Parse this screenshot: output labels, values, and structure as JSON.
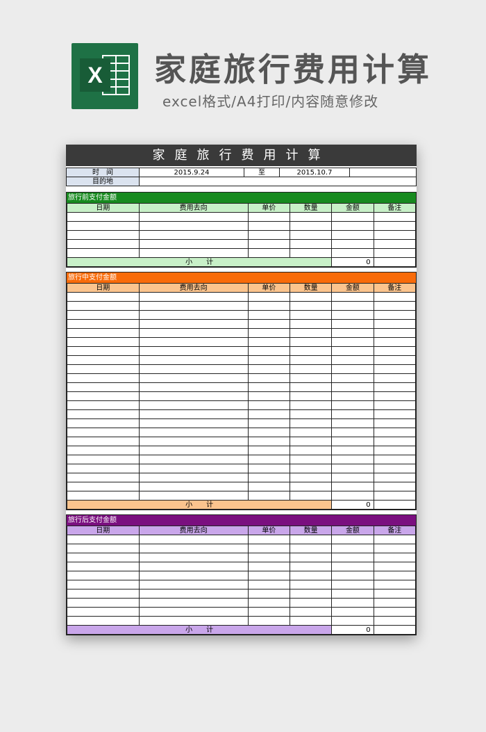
{
  "banner": {
    "logo_letter": "X",
    "title": "家庭旅行费用计算",
    "subtitle": "excel格式/A4打印/内容随意修改"
  },
  "sheet": {
    "title": "家庭旅行费用计算",
    "info": {
      "time_label": "时　间",
      "date_start": "2015.9.24",
      "to_label": "至",
      "date_end": "2015.10.7",
      "destination_label": "目的地",
      "destination_value": ""
    },
    "columns": [
      "日期",
      "费用去向",
      "单价",
      "数量",
      "金额",
      "备注"
    ],
    "sections": [
      {
        "title": "旅行前支付金额",
        "subtotal_label": "小　　计",
        "subtotal_value": "0",
        "rows": 5
      },
      {
        "title": "旅行中支付金额",
        "subtotal_label": "小　　计",
        "subtotal_value": "0",
        "rows": 23
      },
      {
        "title": "旅行后支付金额",
        "subtotal_label": "小　　计",
        "subtotal_value": "0",
        "rows": 10
      }
    ]
  },
  "colors": {
    "green": "#178a1f",
    "orange": "#f86b0a",
    "purple": "#7a0f7f",
    "excel_green": "#1e7145"
  }
}
